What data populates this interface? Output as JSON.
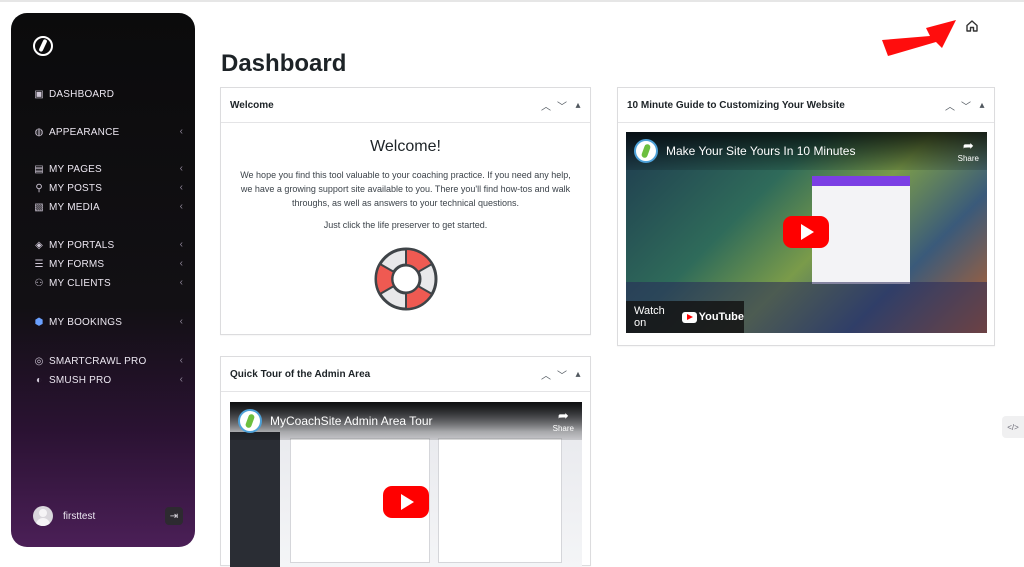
{
  "sidebar": {
    "items": [
      {
        "label": "DASHBOARD",
        "icon": "dashboard-icon",
        "has_submenu": false
      },
      {
        "label": "APPEARANCE",
        "icon": "palette-icon",
        "has_submenu": true
      },
      {
        "label": "MY PAGES",
        "icon": "page-icon",
        "has_submenu": true
      },
      {
        "label": "MY POSTS",
        "icon": "pin-icon",
        "has_submenu": true
      },
      {
        "label": "MY MEDIA",
        "icon": "media-icon",
        "has_submenu": true
      },
      {
        "label": "MY PORTALS",
        "icon": "portal-icon",
        "has_submenu": true
      },
      {
        "label": "MY FORMS",
        "icon": "forms-icon",
        "has_submenu": true
      },
      {
        "label": "MY CLIENTS",
        "icon": "clients-icon",
        "has_submenu": true
      },
      {
        "label": "MY BOOKINGS",
        "icon": "bookings-icon",
        "has_submenu": true
      },
      {
        "label": "SMARTCRAWL PRO",
        "icon": "smartcrawl-icon",
        "has_submenu": true
      },
      {
        "label": "SMUSH PRO",
        "icon": "smush-icon",
        "has_submenu": true
      }
    ],
    "user": {
      "name": "firsttest"
    }
  },
  "header": {
    "title": "Dashboard"
  },
  "panels": {
    "welcome": {
      "title": "Welcome",
      "heading": "Welcome!",
      "paragraph": "We hope you find this tool valuable to your coaching practice. If you need any help, we have a growing support site available to you. There you'll find how-tos and walk throughs, as well as answers to your technical questions.",
      "cta": "Just click the life preserver to get started."
    },
    "guide": {
      "title": "10 Minute Guide to Customizing Your Website",
      "video_title": "Make Your Site Yours In 10 Minutes",
      "share_label": "Share",
      "watch_label": "Watch on",
      "yt_label": "YouTube"
    },
    "tour": {
      "title": "Quick Tour of the Admin Area",
      "video_title": "MyCoachSite Admin Area Tour",
      "share_label": "Share"
    }
  },
  "colors": {
    "accent": "#ff0000",
    "sidebar_bottom": "#4b1f57"
  }
}
